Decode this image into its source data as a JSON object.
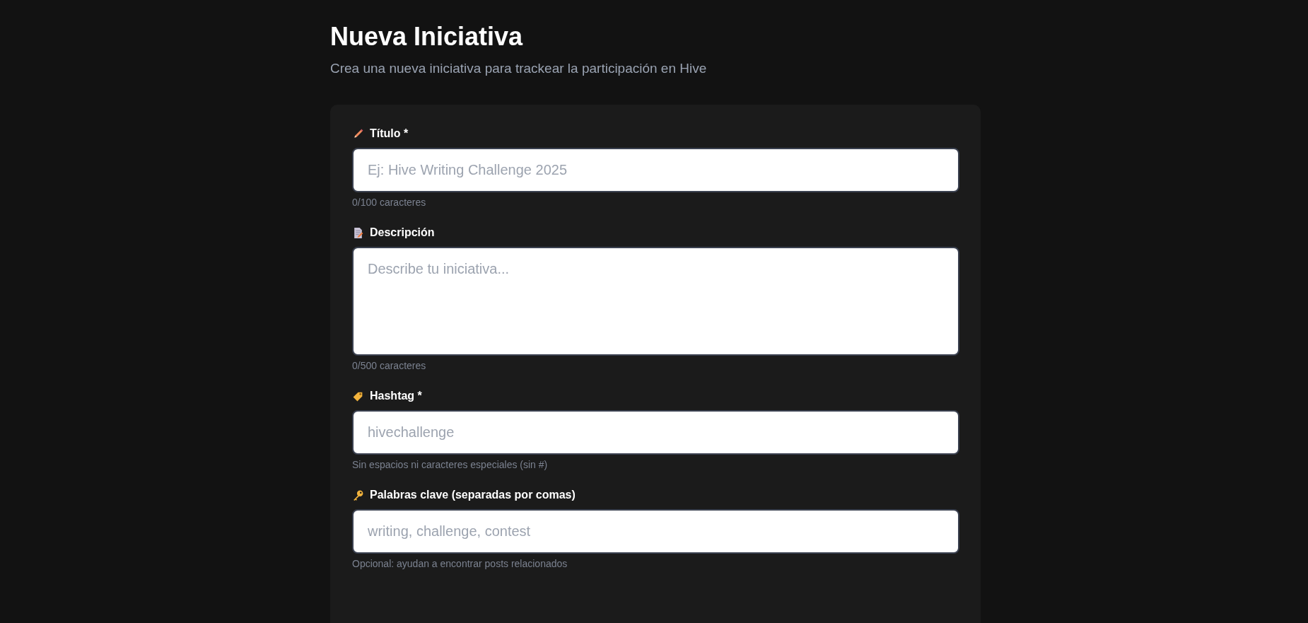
{
  "page": {
    "title": "Nueva Iniciativa",
    "subtitle": "Crea una nueva iniciativa para trackear la participación en Hive"
  },
  "form": {
    "fields": [
      {
        "kind": "input",
        "label": "Título *",
        "placeholder": "Ej: Hive Writing Challenge 2025",
        "hint": "0/100 caracteres"
      },
      {
        "kind": "textarea",
        "label": "Descripción",
        "placeholder": "Describe tu iniciativa...",
        "hint": "0/500 caracteres"
      },
      {
        "kind": "input",
        "label": "Hashtag *",
        "placeholder": "hivechallenge",
        "hint": "Sin espacios ni caracteres especiales (sin #)"
      },
      {
        "kind": "input",
        "label": "Palabras clave (separadas por comas)",
        "placeholder": "writing, challenge, contest",
        "hint": "Opcional: ayudan a encontrar posts relacionados"
      }
    ]
  }
}
